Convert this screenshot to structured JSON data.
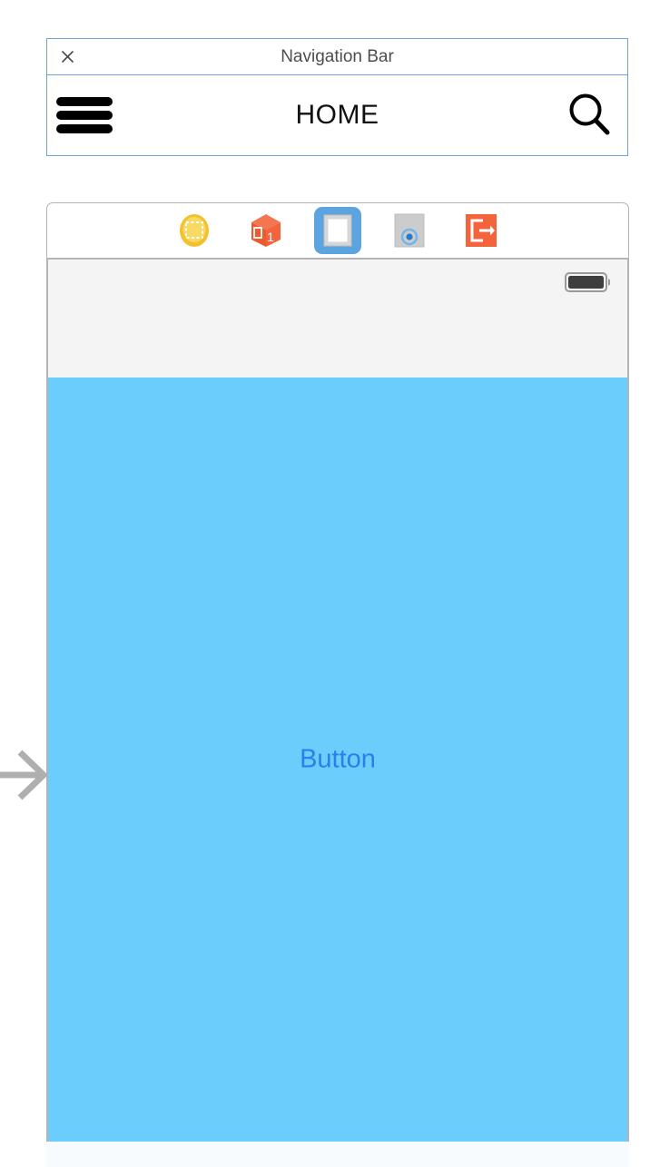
{
  "nav_widget": {
    "titlebar": {
      "close_icon": "close-x-icon",
      "title": "Navigation Bar"
    },
    "bar": {
      "menu_icon": "hamburger-menu-icon",
      "title": "HOME",
      "search_icon": "search-magnifier-icon"
    },
    "border_color": "#6BA3DB"
  },
  "device_panel": {
    "toolbar": {
      "items": [
        {
          "name": "selection-tool-icon",
          "label": "Selection",
          "color": "#F2C12E",
          "selected": false
        },
        {
          "name": "cube-object-icon",
          "label": "Object 1",
          "color": "#F4643C",
          "selected": false
        },
        {
          "name": "screen-frame-icon",
          "label": "Screen",
          "color": "#5BA4DF",
          "selected": true
        },
        {
          "name": "radio-control-icon",
          "label": "Control",
          "color": "#C6C6C6",
          "selected": false
        },
        {
          "name": "exit-transition-icon",
          "label": "Exit",
          "color": "#F4643C",
          "selected": false
        }
      ]
    },
    "status_bar": {
      "battery_icon": "battery-full-icon",
      "battery_level": "100%"
    },
    "canvas": {
      "background_color": "#6BCDFB",
      "button_label": "Button",
      "button_color": "#2A7FE8"
    },
    "border_color": "#B4B4B4"
  },
  "left_arrow": {
    "icon": "arrow-right-icon",
    "color": "#AFAFAF"
  }
}
